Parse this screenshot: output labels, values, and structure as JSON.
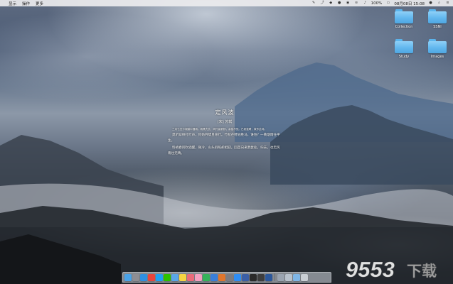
{
  "menubar": {
    "apple_icon": "apple-logo",
    "menus": [
      "显示",
      "操作",
      "更多"
    ],
    "right_text": "08月08日 15:08",
    "battery": "100%",
    "status_icons": [
      "notes-icon",
      "share-icon",
      "dropbox-icon",
      "qq-icon",
      "wechat-icon",
      "wifi-icon",
      "volume-icon",
      "battery-icon",
      "user-icon",
      "search-icon",
      "menu-icon"
    ]
  },
  "desktop": {
    "folders": [
      {
        "label": "Collection"
      },
      {
        "label": "SSNI"
      },
      {
        "label": "Study"
      },
      {
        "label": "Images"
      }
    ]
  },
  "poem": {
    "title": "定风波",
    "author": "[宋] 苏轼",
    "preface": "三月七日沙湖道中遇雨。雨具先去，同行皆狼狈，余独不觉。已而遂晴，故作此词。",
    "verses": [
      "莫听穿林打叶声，何妨吟啸且徐行。竹杖芒鞋轻胜马，谁怕？一蓑烟雨任平生。",
      "料峭春风吹酒醒，微冷，山头斜照却相迎。回首向来萧瑟处，归去，也无风雨也无晴。"
    ]
  },
  "dock": {
    "icons": [
      {
        "name": "finder-icon",
        "color": "#4aa3e8"
      },
      {
        "name": "launchpad-icon",
        "color": "#8e8e93"
      },
      {
        "name": "safari-icon",
        "color": "#2f8fe0"
      },
      {
        "name": "chrome-icon",
        "color": "#e8453c"
      },
      {
        "name": "qq-icon",
        "color": "#1da1f2"
      },
      {
        "name": "wechat-icon",
        "color": "#2dc100"
      },
      {
        "name": "mail-icon",
        "color": "#5aa7e8"
      },
      {
        "name": "notes-icon",
        "color": "#f5d442"
      },
      {
        "name": "photos-icon",
        "color": "#e86a7a"
      },
      {
        "name": "music-icon",
        "color": "#f2a0c0"
      },
      {
        "name": "numbers-icon",
        "color": "#35b35a"
      },
      {
        "name": "keynote-icon",
        "color": "#3a7fd9"
      },
      {
        "name": "matlab-icon",
        "color": "#e0762d"
      },
      {
        "name": "preferences-icon",
        "color": "#7c7c82"
      },
      {
        "name": "appstore-icon",
        "color": "#2e8ef5"
      },
      {
        "name": "xcode-icon",
        "color": "#3b5fa6"
      },
      {
        "name": "terminal-icon",
        "color": "#2a2a2a"
      },
      {
        "name": "activity-icon",
        "color": "#3d3d3d"
      },
      {
        "name": "word-icon",
        "color": "#2b579a"
      },
      {
        "name": "downloads-icon",
        "color": "#9aa4b0"
      },
      {
        "name": "documents-icon",
        "color": "#b8c2cc"
      },
      {
        "name": "folder-icon",
        "color": "#7fb6e6"
      },
      {
        "name": "trash-icon",
        "color": "#c9ced4"
      }
    ]
  },
  "watermark": {
    "number": "9553",
    "text": "下载"
  }
}
